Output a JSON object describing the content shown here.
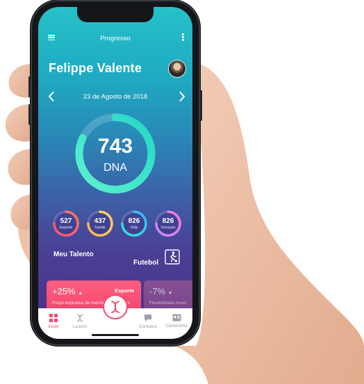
{
  "header": {
    "title": "Progresso",
    "user_name": "Felippe Valente"
  },
  "date_nav": {
    "date": "23 de Agosto de 2018"
  },
  "score": {
    "value": "743",
    "label": "DNA",
    "ring_fraction": 0.82
  },
  "categories": [
    {
      "value": "527",
      "label": "Esporte",
      "color_start": "#ff4f7b",
      "color_end": "#ff7a5c",
      "fraction": 0.75
    },
    {
      "value": "437",
      "label": "Saúde",
      "color_start": "#ffb347",
      "color_end": "#ffd36b",
      "fraction": 0.75
    },
    {
      "value": "826",
      "label": "Vida",
      "color_start": "#2ee6d6",
      "color_end": "#3ab7ff",
      "fraction": 0.75
    },
    {
      "value": "826",
      "label": "Vocação",
      "color_start": "#c38bff",
      "color_end": "#ff7ad6",
      "fraction": 0.75
    }
  ],
  "talent": {
    "title": "Meu Talento",
    "value": "Futebol"
  },
  "cards": [
    {
      "percent": "+25%",
      "tag": "Esporte",
      "description": "Força explosiva de membros inferiores"
    },
    {
      "percent": "-7%",
      "tag": "",
      "description": "Flexibilidade musc"
    }
  ],
  "tabs": [
    {
      "label": "Início",
      "icon": "grid-icon",
      "active": true
    },
    {
      "label": "Laudos",
      "icon": "dna-icon",
      "active": false
    },
    {
      "label": "Contatos",
      "icon": "chat-icon",
      "active": false
    },
    {
      "label": "Carteirinha",
      "icon": "id-card-icon",
      "active": false
    }
  ],
  "colors": {
    "accent_pink": "#ef4b72",
    "ring_teal": "#2ee8c8"
  }
}
